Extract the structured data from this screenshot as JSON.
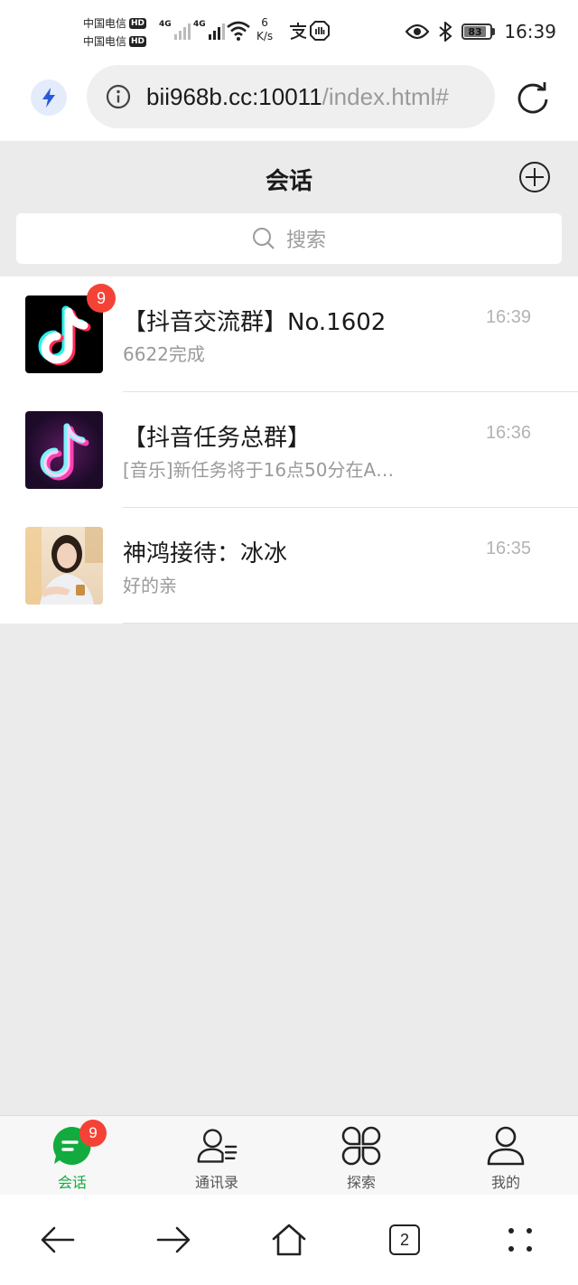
{
  "status_bar": {
    "carrier_1": "中国电信",
    "carrier_2": "中国电信",
    "hd": "HD",
    "net_type_1": "4G",
    "net_type_2": "4G",
    "speed_value": "6",
    "speed_unit": "K/s",
    "battery": "83",
    "time": "16:39",
    "icons": [
      "signal-icon",
      "wifi-icon",
      "alipay-icon",
      "shield-icon",
      "eye-icon",
      "bluetooth-icon",
      "battery-icon"
    ]
  },
  "browser": {
    "url_host": "bii968b.cc:10011",
    "url_path": "/index.html#",
    "tab_count": "2"
  },
  "header": {
    "title": "会话",
    "search_placeholder": "搜索"
  },
  "chats": [
    {
      "name": "【抖音交流群】No.1602",
      "preview": "6622完成",
      "time": "16:39",
      "badge": "9"
    },
    {
      "name": "【抖音任务总群】",
      "preview": "[音乐]新任务将于16点50分在A…",
      "time": "16:36"
    },
    {
      "name": "神鸿接待：冰冰",
      "preview": "好的亲",
      "time": "16:35"
    }
  ],
  "tabbar": {
    "items": [
      {
        "label": "会话",
        "badge": "9"
      },
      {
        "label": "通讯录"
      },
      {
        "label": "探索"
      },
      {
        "label": "我的"
      }
    ]
  },
  "colors": {
    "accent_green": "#13ab3f",
    "badge_red": "#f44336",
    "page_bg": "#ebebeb"
  }
}
